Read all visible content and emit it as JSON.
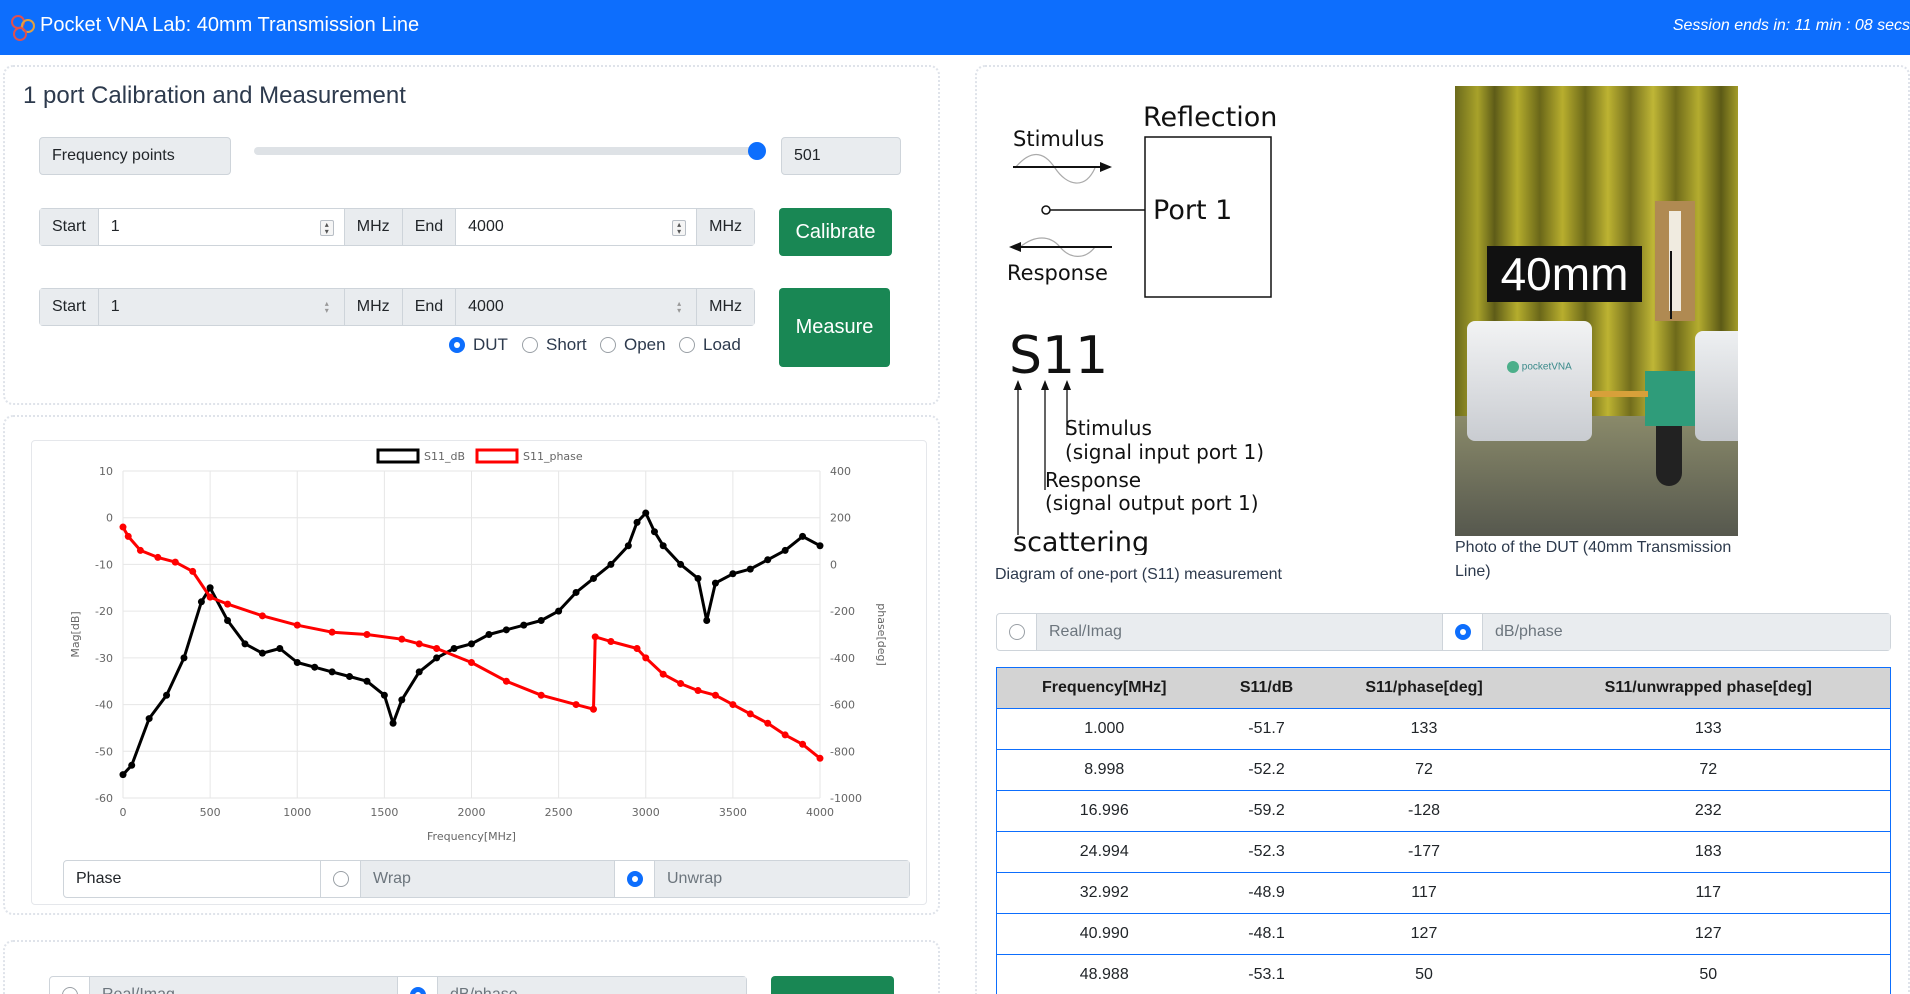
{
  "header": {
    "title": "Pocket VNA Lab: 40mm Transmission Line",
    "session": "Session ends in: 11 min : 08 secs"
  },
  "calibration": {
    "title": "1 port Calibration and Measurement",
    "freq_points_label": "Frequency points",
    "freq_points_value": "501",
    "slider_level": 1.0,
    "cal_row": {
      "start_label": "Start",
      "start_value": "1",
      "unit1": "MHz",
      "end_label": "End",
      "end_value": "4000",
      "unit2": "MHz"
    },
    "meas_row": {
      "start_label": "Start",
      "start_value": "1",
      "unit1": "MHz",
      "end_label": "End",
      "end_value": "4000",
      "unit2": "MHz"
    },
    "calibrate_label": "Calibrate",
    "measure_label": "Measure",
    "standards": [
      {
        "label": "DUT",
        "selected": true
      },
      {
        "label": "Short",
        "selected": false
      },
      {
        "label": "Open",
        "selected": false
      },
      {
        "label": "Load",
        "selected": false
      }
    ]
  },
  "chart_data": {
    "type": "line",
    "xlabel": "Frequency[MHz]",
    "ylabel": "Mag[dB]",
    "y2label": "phase[deg]",
    "xlim": [
      0,
      4000
    ],
    "ylim": [
      -60,
      10
    ],
    "y2lim": [
      -1000,
      400
    ],
    "x_ticks": [
      "0",
      "500",
      "1000",
      "1500",
      "2000",
      "2500",
      "3000",
      "3500",
      "4000"
    ],
    "y_ticks": [
      "10",
      "0",
      "-10",
      "-20",
      "-30",
      "-40",
      "-50",
      "-60"
    ],
    "y2_ticks": [
      "400",
      "200",
      "0",
      "-200",
      "-400",
      "-600",
      "-800",
      "-1000"
    ],
    "grid": true,
    "legend_position": "top",
    "series": [
      {
        "name": "S11_dB",
        "color": "#000000",
        "x": [
          0,
          50,
          150,
          250,
          350,
          450,
          500,
          600,
          700,
          800,
          900,
          1000,
          1100,
          1200,
          1300,
          1400,
          1500,
          1550,
          1600,
          1700,
          1800,
          1900,
          2000,
          2100,
          2200,
          2300,
          2400,
          2500,
          2600,
          2700,
          2800,
          2900,
          2950,
          3000,
          3050,
          3100,
          3200,
          3300,
          3350,
          3400,
          3500,
          3600,
          3700,
          3800,
          3900,
          4000
        ],
        "y": [
          -55,
          -53,
          -43,
          -38,
          -30,
          -18,
          -15,
          -22,
          -27,
          -29,
          -28,
          -31,
          -32,
          -33,
          -34,
          -35,
          -38,
          -44,
          -39,
          -33,
          -30,
          -28,
          -27,
          -25,
          -24,
          -23,
          -22,
          -20,
          -16,
          -13,
          -10,
          -6,
          -1,
          1,
          -3,
          -6,
          -10,
          -13,
          -22,
          -14,
          -12,
          -11,
          -9,
          -7,
          -4,
          -6
        ]
      },
      {
        "name": "S11_phase",
        "color": "#ff0000",
        "x": [
          0,
          30,
          100,
          200,
          300,
          400,
          500,
          600,
          800,
          1000,
          1200,
          1400,
          1600,
          1700,
          1800,
          2000,
          2200,
          2400,
          2600,
          2700,
          2710,
          2800,
          2950,
          3000,
          3100,
          3200,
          3300,
          3400,
          3500,
          3600,
          3700,
          3800,
          3900,
          4000
        ],
        "y": [
          160,
          120,
          60,
          30,
          10,
          -30,
          -140,
          -170,
          -220,
          -260,
          -290,
          -300,
          -320,
          -340,
          -360,
          -420,
          -500,
          -560,
          -600,
          -620,
          -310,
          -330,
          -360,
          -400,
          -470,
          -510,
          -540,
          -560,
          -600,
          -640,
          -680,
          -730,
          -770,
          -830
        ]
      }
    ]
  },
  "phase_control": {
    "label": "Phase",
    "options": [
      {
        "label": "Wrap",
        "selected": false
      },
      {
        "label": "Unwrap",
        "selected": true
      }
    ]
  },
  "bottom_strip": {
    "options": [
      {
        "label": "Real/Imag",
        "selected": false
      },
      {
        "label": "dB/phase",
        "selected": true
      }
    ]
  },
  "diagram": {
    "reflection": "Reflection",
    "stimulus": "Stimulus",
    "response": "Response",
    "port": "Port 1",
    "s11": "S11",
    "ann_stimulus_1": "Stimulus",
    "ann_stimulus_2": "(signal input port 1)",
    "ann_response_1": "Response",
    "ann_response_2": "(signal output port 1)",
    "ann_scattering": "scattering",
    "caption": "Diagram of one-port (S11) measurement"
  },
  "photo": {
    "overlay": "40mm",
    "caption_line1": "Photo of the DUT (40mm Transmission",
    "caption_line2": "Line)",
    "brand": "pocketVNA"
  },
  "table_format": {
    "options": [
      {
        "label": "Real/Imag",
        "selected": false
      },
      {
        "label": "dB/phase",
        "selected": true
      }
    ]
  },
  "results_table": {
    "headers": [
      "Frequency[MHz]",
      "S11/dB",
      "S11/phase[deg]",
      "S11/unwrapped phase[deg]"
    ],
    "rows": [
      [
        "1.000",
        "-51.7",
        "133",
        "133"
      ],
      [
        "8.998",
        "-52.2",
        "72",
        "72"
      ],
      [
        "16.996",
        "-59.2",
        "-128",
        "232"
      ],
      [
        "24.994",
        "-52.3",
        "-177",
        "183"
      ],
      [
        "32.992",
        "-48.9",
        "117",
        "117"
      ],
      [
        "40.990",
        "-48.1",
        "127",
        "127"
      ],
      [
        "48.988",
        "-53.1",
        "50",
        "50"
      ]
    ]
  }
}
